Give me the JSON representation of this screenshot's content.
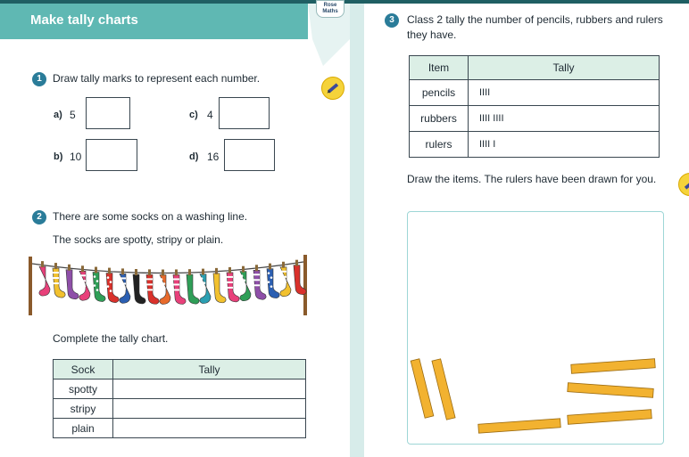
{
  "header": {
    "title": "Make tally charts",
    "logo_text": "Rose Maths"
  },
  "q1": {
    "number": "1",
    "prompt": "Draw tally marks to represent each number.",
    "items": [
      {
        "label": "a)",
        "value": "5"
      },
      {
        "label": "c)",
        "value": "4"
      },
      {
        "label": "b)",
        "value": "10"
      },
      {
        "label": "d)",
        "value": "16"
      }
    ]
  },
  "q2": {
    "number": "2",
    "prompt": "There are some socks on a washing line.",
    "prompt2": "The socks are spotty, stripy or plain.",
    "instruction": "Complete the tally chart.",
    "table": {
      "headers": [
        "Sock",
        "Tally"
      ],
      "rows": [
        "spotty",
        "stripy",
        "plain"
      ]
    },
    "socks": [
      {
        "color": "#e8407a",
        "pattern": "plain"
      },
      {
        "color": "#f2c12e",
        "pattern": "stripy"
      },
      {
        "color": "#8e4fa8",
        "pattern": "plain"
      },
      {
        "color": "#e8407a",
        "pattern": "stripy"
      },
      {
        "color": "#2f9e57",
        "pattern": "spotty"
      },
      {
        "color": "#d9312b",
        "pattern": "spotty"
      },
      {
        "color": "#2b5fb2",
        "pattern": "stripy"
      },
      {
        "color": "#222222",
        "pattern": "plain"
      },
      {
        "color": "#d9312b",
        "pattern": "stripy"
      },
      {
        "color": "#e86a2b",
        "pattern": "spotty"
      },
      {
        "color": "#e8407a",
        "pattern": "stripy"
      },
      {
        "color": "#2f9e57",
        "pattern": "plain"
      },
      {
        "color": "#2b9fb2",
        "pattern": "spotty"
      },
      {
        "color": "#f2c12e",
        "pattern": "plain"
      },
      {
        "color": "#e8407a",
        "pattern": "stripy"
      },
      {
        "color": "#2f9e57",
        "pattern": "spotty"
      },
      {
        "color": "#8e4fa8",
        "pattern": "stripy"
      },
      {
        "color": "#2b5fb2",
        "pattern": "spotty"
      },
      {
        "color": "#f2c12e",
        "pattern": "stripy"
      },
      {
        "color": "#d9312b",
        "pattern": "plain"
      }
    ]
  },
  "q3": {
    "number": "3",
    "prompt": "Class 2 tally the number of pencils, rubbers and rulers they have.",
    "table": {
      "headers": [
        "Item",
        "Tally"
      ],
      "rows": [
        {
          "item": "pencils",
          "tally": "IIII",
          "count": 4
        },
        {
          "item": "rubbers",
          "tally": "IIII IIII",
          "count": 9
        },
        {
          "item": "rulers",
          "tally": "IIII I",
          "count": 6
        }
      ]
    },
    "instruction": "Draw the items. The rulers have been drawn for you.",
    "ruler_color": "#f2b230"
  }
}
